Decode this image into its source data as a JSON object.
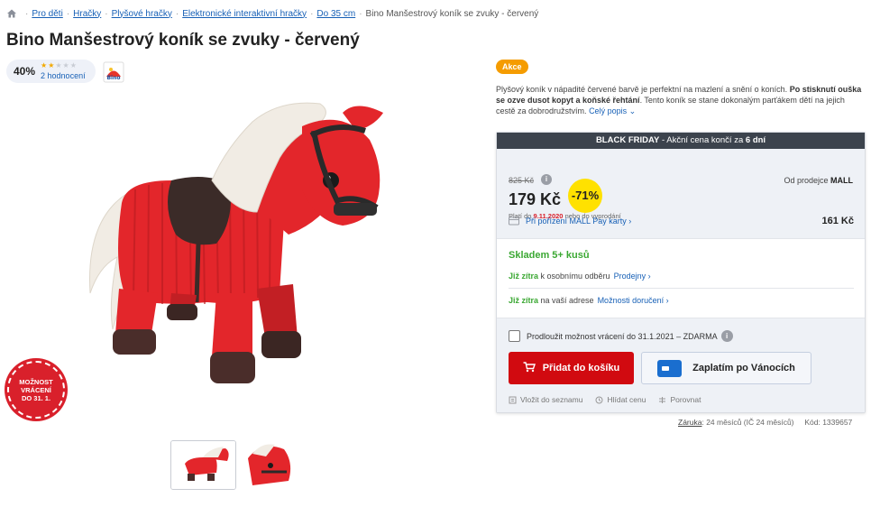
{
  "breadcrumb": {
    "items": [
      "Pro děti",
      "Hračky",
      "Plyšové hračky",
      "Elektronické interaktivní hračky",
      "Do 35 cm"
    ],
    "current": "Bino Manšestrový koník se zvuky - červený"
  },
  "product": {
    "title": "Bino Manšestrový koník se zvuky - červený",
    "rating_percent": "40%",
    "stars_filled": 2,
    "stars_total": 5,
    "reviews_label": "2 hodnocení",
    "brand_logo_text": "Bino",
    "return_badge": [
      "MOŽNOST",
      "VRÁCENÍ",
      "DO 31. 1."
    ]
  },
  "promo": {
    "badge": "Akce",
    "description_part1": "Plyšový koník v nápadité červené barvě je perfektní na mazlení a snění o koních. ",
    "description_bold": "Po stisknutí ouška se ozve dusot kopyt a koňské řehtání",
    "description_part2": ". Tento koník se stane dokonalým parťákem dětí na jejich cestě za dobrodružstvím.",
    "description_more": "Celý popis"
  },
  "buybox": {
    "banner_prefix": "BLACK FRIDAY",
    "banner_suffix": " - Akční cena končí za ",
    "banner_days": "6 dní",
    "old_price": "825 Kč",
    "new_price": "179 Kč",
    "discount": "-71%",
    "valid_prefix": "Platí do ",
    "valid_date": "9.11.2020",
    "valid_suffix": " nebo do vyprodání",
    "seller_prefix": "Od prodejce ",
    "seller_name": "MALL",
    "mallpay_label": "Při pořízení MALL Pay karty",
    "mallpay_price": "161 Kč",
    "stock": "Skladem 5+ kusů",
    "delivery1_day": "Již zítra",
    "delivery1_text": " k osobnímu odběru",
    "delivery1_link": "Prodejny",
    "delivery2_day": "Již zítra",
    "delivery2_text": " na vaší adrese",
    "delivery2_link": "Možnosti doručení",
    "extend_return": "Prodloužit možnost vrácení do 31.1.2021 – ZDARMA",
    "add_to_cart": "Přidat do košíku",
    "pay_xmas": "Zaplatím po Vánocích",
    "action_wishlist": "Vložit do seznamu",
    "action_watch": "Hlídat cenu",
    "action_compare": "Porovnat"
  },
  "meta": {
    "warranty_label": "Záruka",
    "warranty_value": ": 24 měsíců (IČ 24 měsíců)",
    "code_label": "Kód: ",
    "code_value": "1339657"
  },
  "colors": {
    "primary_link": "#1760b6",
    "cart_button": "#d10a10",
    "stock_green": "#3ba833",
    "discount_yellow": "#ffe100",
    "promo_orange": "#f59c00"
  }
}
